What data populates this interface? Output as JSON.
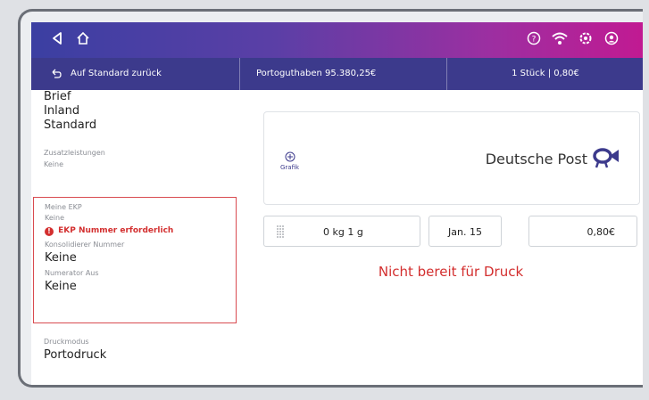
{
  "header": {
    "back_icon": "back-arrow-icon",
    "home_icon": "home-icon",
    "help_icon": "help-icon",
    "wifi_icon": "wifi-icon",
    "settings_icon": "settings-icon",
    "account_icon": "account-icon"
  },
  "subbar": {
    "reset_label": "Auf Standard zurück",
    "balance_label": "Portoguthaben 95.380,25€",
    "count_label": "1 Stück | 0,80€"
  },
  "sidebar": {
    "product_lines": [
      "Brief",
      "Inland",
      "Standard"
    ],
    "zusatz_label": "Zusatzleistungen",
    "zusatz_value": "Keine",
    "ekp_label": "Meine EKP",
    "ekp_value": "Keine",
    "ekp_error": "EKP Nummer erforderlich",
    "kons_label": "Konsolidierer Nummer",
    "kons_value": "Keine",
    "numerator_label": "Numerator Aus",
    "numerator_value": "Keine",
    "druckmodus_label": "Druckmodus",
    "druckmodus_value": "Portodruck"
  },
  "main": {
    "grafik_label": "Grafik",
    "brand": "Deutsche Post",
    "weight": "0 kg 1 g",
    "date": "Jan. 15",
    "price": "0,80€",
    "status": "Nicht bereit für Druck"
  },
  "colors": {
    "accent": "#3c3a8c",
    "error": "#d32f2f",
    "brand_gradient_end": "#c11a92"
  }
}
